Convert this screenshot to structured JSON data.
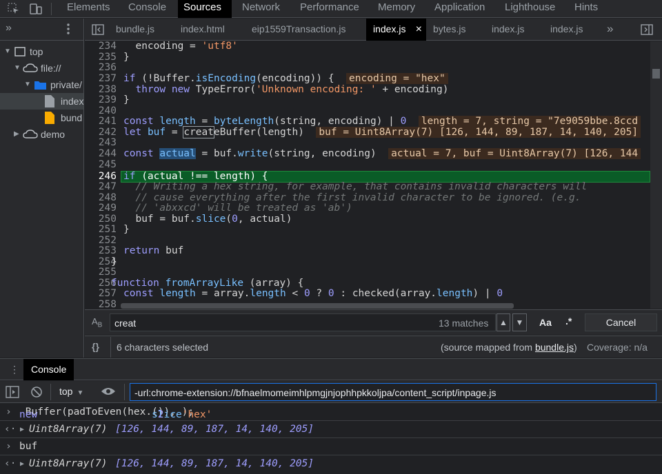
{
  "panel_tabs": [
    "Elements",
    "Console",
    "Sources",
    "Network",
    "Performance",
    "Memory",
    "Application",
    "Lighthouse",
    "Hints"
  ],
  "navigator": {
    "items": [
      {
        "label": "top",
        "icon": "frame-icon"
      },
      {
        "label": "file://",
        "icon": "cloud-icon"
      },
      {
        "label": "private/",
        "icon": "folder-icon"
      },
      {
        "label": "index",
        "icon": "file-icon"
      },
      {
        "label": "bund",
        "icon": "file-js-icon"
      },
      {
        "label": "demo",
        "icon": "cloud-icon"
      }
    ]
  },
  "file_tabs": [
    "bundle.js",
    "index.html",
    "eip1559Transaction.js",
    "index.js",
    "bytes.js",
    "index.js",
    "index.js"
  ],
  "file_tab_close": "×",
  "editor": {
    "line_numbers": [
      "234",
      "235",
      "236",
      "237",
      "238",
      "239",
      "240",
      "241",
      "242",
      "243",
      "244",
      "245",
      "246",
      "247",
      "248",
      "249",
      "250",
      "251",
      "252",
      "253",
      "254",
      "255",
      "256",
      "257",
      "258"
    ],
    "inline_values": [
      "encoding = \"hex\"",
      "length = 7, string = \"7e9059bbe.8ccd",
      "buf = Uint8Array(7) [126, 144, 89, 187, 14, 140, 205]",
      "actual = 7, buf = Uint8Array(7) [126, 144"
    ]
  },
  "search": {
    "icon_label": "A",
    "icon_sub": "B",
    "query": "creat",
    "matches": "13 matches",
    "match_case": "Aa",
    "regex": ".*",
    "cancel": "Cancel"
  },
  "status": {
    "braces": "{}",
    "selection": "6 characters selected",
    "source_mapped_prefix": "(source mapped from ",
    "source_mapped_file": "bundle.js",
    "source_mapped_suffix": ")",
    "coverage": "Coverage: n/a"
  },
  "drawer": {
    "tab": "Console"
  },
  "console_toolbar": {
    "context": "top",
    "filter": "-url:chrome-extension://bfnaelmomeimhlpmgjnjophhpkkoljpa/content_script/inpage.js"
  },
  "console": {
    "input1": "new Buffer(padToEven(hex.slice(2)), 'hex');",
    "result1_type": "Uint8Array(7)",
    "result1_values": "[126, 144, 89, 187, 14, 140, 205]",
    "input2": "buf",
    "result2_type": "Uint8Array(7)",
    "result2_values": "[126, 144, 89, 187, 14, 140, 205]"
  },
  "colors": {
    "accent": "#0a5c27",
    "keyword": "#9e9eff",
    "string": "#f29766",
    "function": "#79c0ff"
  }
}
